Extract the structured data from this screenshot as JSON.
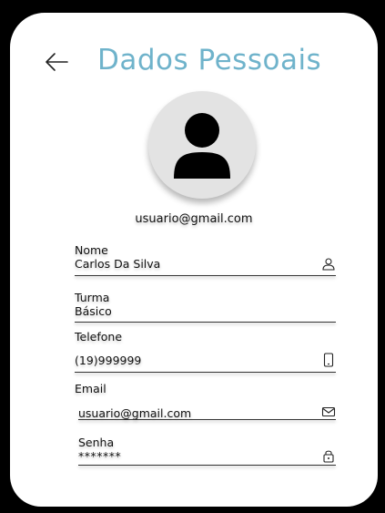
{
  "header": {
    "title": "Dados Pessoais"
  },
  "profile": {
    "email": "usuario@gmail.com"
  },
  "fields": {
    "nome": {
      "label": "Nome",
      "value": "Carlos Da Silva",
      "icon": "user-icon"
    },
    "turma": {
      "label": "Turma",
      "value": "Básico"
    },
    "telefone": {
      "label": "Telefone",
      "value": "(19)999999",
      "icon": "phone-icon"
    },
    "email": {
      "label": "Email",
      "value": "usuario@gmail.com",
      "icon": "mail-icon"
    },
    "senha": {
      "label": "Senha",
      "value": "*******",
      "icon": "lock-icon"
    }
  },
  "colors": {
    "accent": "#6fb3cb",
    "background": "#000000",
    "card": "#ffffff",
    "avatar_bg": "#e3e3e3"
  }
}
